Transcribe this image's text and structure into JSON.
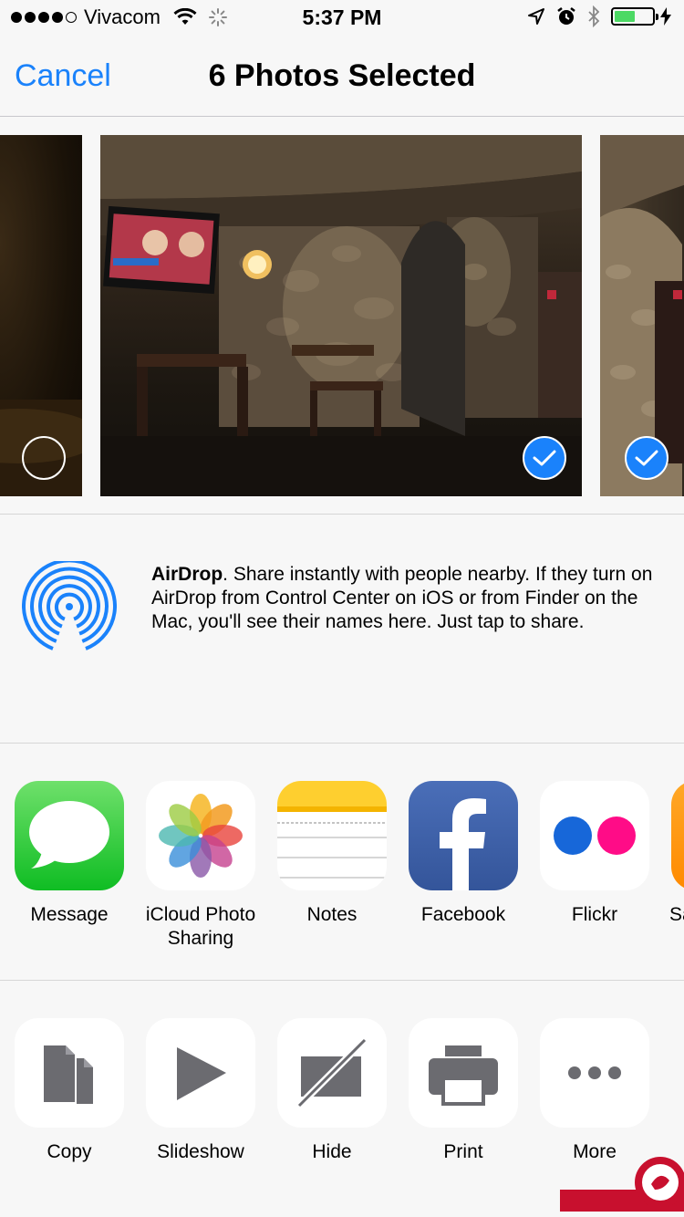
{
  "status_bar": {
    "carrier": "Vivacom",
    "time": "5:37 PM",
    "battery_level": 0.55,
    "battery_color": "#4cd964"
  },
  "nav": {
    "cancel_label": "Cancel",
    "title": "6 Photos Selected"
  },
  "photos": [
    {
      "name": "photo-dark-left",
      "selected": false
    },
    {
      "name": "photo-restaurant-interior",
      "selected": true
    },
    {
      "name": "photo-stone-wall-right",
      "selected": true
    }
  ],
  "airdrop": {
    "title": "AirDrop",
    "description": ". Share instantly with people nearby. If they turn on AirDrop from Control Center on iOS or from Finder on the Mac, you'll see their names here. Just tap to share."
  },
  "share_apps": [
    {
      "label": "Message",
      "icon": "message-icon"
    },
    {
      "label": "iCloud Photo Sharing",
      "icon": "photos-icon"
    },
    {
      "label": "Notes",
      "icon": "notes-icon"
    },
    {
      "label": "Facebook",
      "icon": "facebook-icon"
    },
    {
      "label": "Flickr",
      "icon": "flickr-icon"
    },
    {
      "label": "Sa",
      "icon": "app-icon"
    }
  ],
  "actions": [
    {
      "label": "Copy",
      "icon": "copy-icon"
    },
    {
      "label": "Slideshow",
      "icon": "play-icon"
    },
    {
      "label": "Hide",
      "icon": "hide-icon"
    },
    {
      "label": "Print",
      "icon": "printer-icon"
    },
    {
      "label": "More",
      "icon": "more-icon"
    }
  ],
  "colors": {
    "accent": "#1a82fb",
    "separator": "#d6d6d6",
    "background": "#f7f7f7"
  }
}
